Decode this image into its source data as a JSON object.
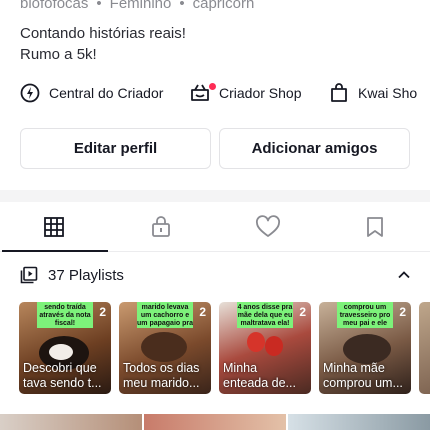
{
  "profile": {
    "username": "blofofocas",
    "gender": "Feminino",
    "sign": "capricorn",
    "bio_lines": [
      "Contando histórias reais!",
      "Rumo a 5k!"
    ]
  },
  "links": [
    {
      "label": "Central do Criador",
      "icon": "creator-center-icon"
    },
    {
      "label": "Criador Shop",
      "icon": "shop-basket-icon",
      "has_notification_dot": true
    },
    {
      "label": "Kwai Sho",
      "icon": "shopping-bag-icon"
    }
  ],
  "buttons": {
    "edit_profile": "Editar perfil",
    "add_friends": "Adicionar amigos"
  },
  "tabs": [
    {
      "name": "videos-grid",
      "icon": "grid-icon",
      "active": true
    },
    {
      "name": "private",
      "icon": "lock-icon",
      "active": false
    },
    {
      "name": "liked",
      "icon": "heart-icon",
      "active": false
    },
    {
      "name": "saved",
      "icon": "bookmark-icon",
      "active": false
    }
  ],
  "playlists": {
    "label": "37 Playlists",
    "expanded": true,
    "items": [
      {
        "sticker": "sendo traída através da nota fiscal!",
        "count": "2",
        "caption": [
          "Descobri que",
          "tava sendo t..."
        ]
      },
      {
        "sticker": "marido levava um cachorro e um papagaio pra casa",
        "count": "2",
        "caption": [
          "Todos os dias",
          "meu marido..."
        ]
      },
      {
        "sticker": "4 anos disse pra mãe dela que eu maltratava ela!",
        "count": "2",
        "caption": [
          "Minha",
          "enteada de..."
        ]
      },
      {
        "sticker": "comprou um travesseiro pro meu pai e ele enlouqueceu!",
        "count": "2",
        "caption": [
          "Minha mãe",
          "comprou um..."
        ]
      }
    ]
  },
  "colors": {
    "accent_red": "#fe2c55",
    "sticker_green": "#7df27a",
    "text_primary": "#161823",
    "text_secondary": "#8a8b91"
  }
}
